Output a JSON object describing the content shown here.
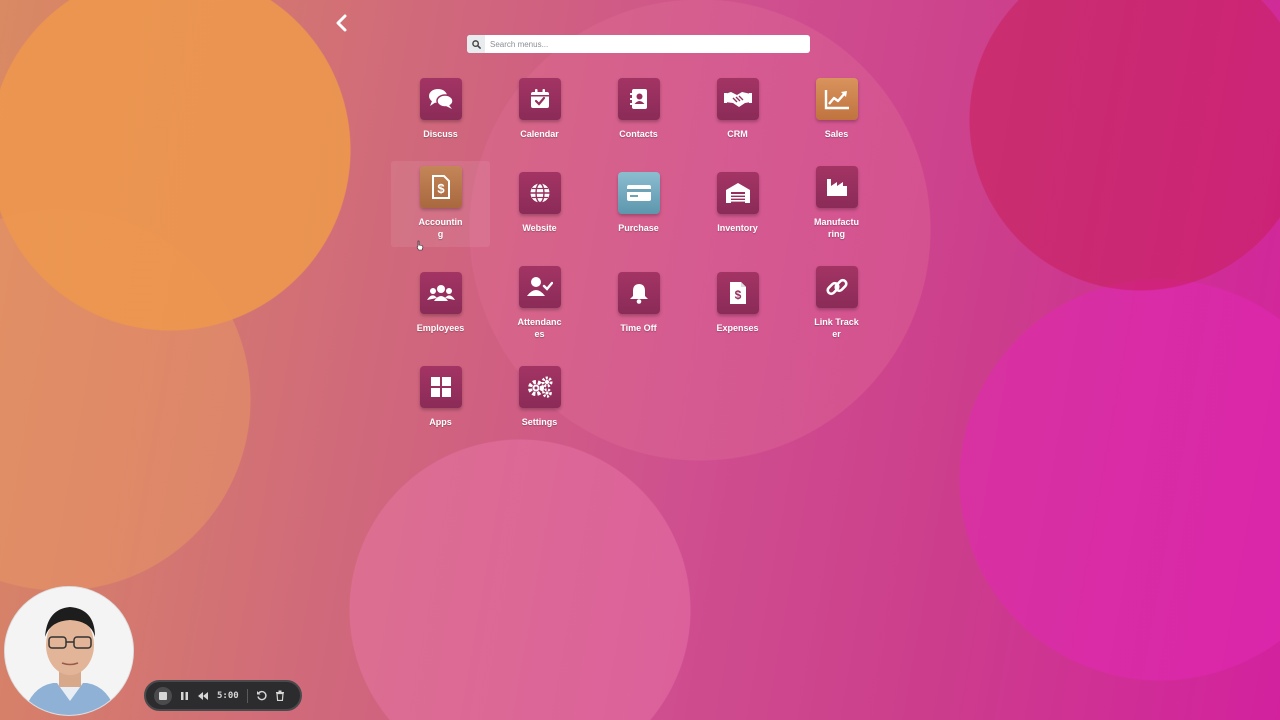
{
  "nav": {
    "back_icon": "chevron-left-icon"
  },
  "search": {
    "placeholder": "Search menus...",
    "value": "",
    "icon": "search-icon"
  },
  "apps": [
    {
      "label": "Discuss",
      "icon": "chat-bubbles-icon"
    },
    {
      "label": "Calendar",
      "icon": "calendar-check-icon"
    },
    {
      "label": "Contacts",
      "icon": "address-book-icon"
    },
    {
      "label": "CRM",
      "icon": "handshake-icon"
    },
    {
      "label": "Sales",
      "icon": "chart-trend-icon"
    },
    {
      "label": "Accounting",
      "icon": "dollar-document-icon"
    },
    {
      "label": "Website",
      "icon": "globe-icon"
    },
    {
      "label": "Purchase",
      "icon": "credit-card-icon"
    },
    {
      "label": "Inventory",
      "icon": "warehouse-icon"
    },
    {
      "label": "Manufacturing",
      "icon": "factory-icon"
    },
    {
      "label": "Employees",
      "icon": "users-icon"
    },
    {
      "label": "Attendances",
      "icon": "user-check-icon"
    },
    {
      "label": "Time Off",
      "icon": "bell-icon"
    },
    {
      "label": "Expenses",
      "icon": "receipt-dollar-icon"
    },
    {
      "label": "Link Tracker",
      "icon": "link-icon"
    },
    {
      "label": "Apps",
      "icon": "grid-icon"
    },
    {
      "label": "Settings",
      "icon": "gears-icon"
    }
  ],
  "recorder": {
    "timer": "5:00"
  },
  "colors": {
    "tile": "#962f5e",
    "sales_tile": "#cf8650",
    "purchase_tile": "#72a8bd"
  }
}
